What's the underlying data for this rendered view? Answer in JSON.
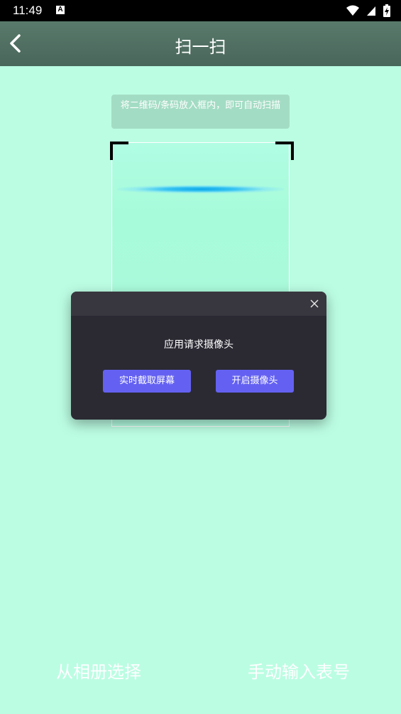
{
  "status_bar": {
    "time": "11:49",
    "notification_icon": "A",
    "icons": [
      "wifi-icon",
      "signal-icon",
      "battery-charging-icon"
    ]
  },
  "header": {
    "title": "扫一扫",
    "back_icon": "chevron-left-icon"
  },
  "scanner": {
    "hint": "将二维码/条码放入框内，即可自动扫描"
  },
  "dialog": {
    "message": "应用请求摄像头",
    "screen_capture_label": "实时截取屏幕",
    "open_camera_label": "开启摄像头",
    "close_icon": "close-icon"
  },
  "bottom": {
    "album_label": "从相册选择",
    "manual_input_label": "手动输入表号"
  },
  "colors": {
    "background": "#bbfde3",
    "header": "#4f6d60",
    "dialog_bg": "#2b2a33",
    "button": "#6461f2",
    "scan_line": "#0aa6e8"
  }
}
